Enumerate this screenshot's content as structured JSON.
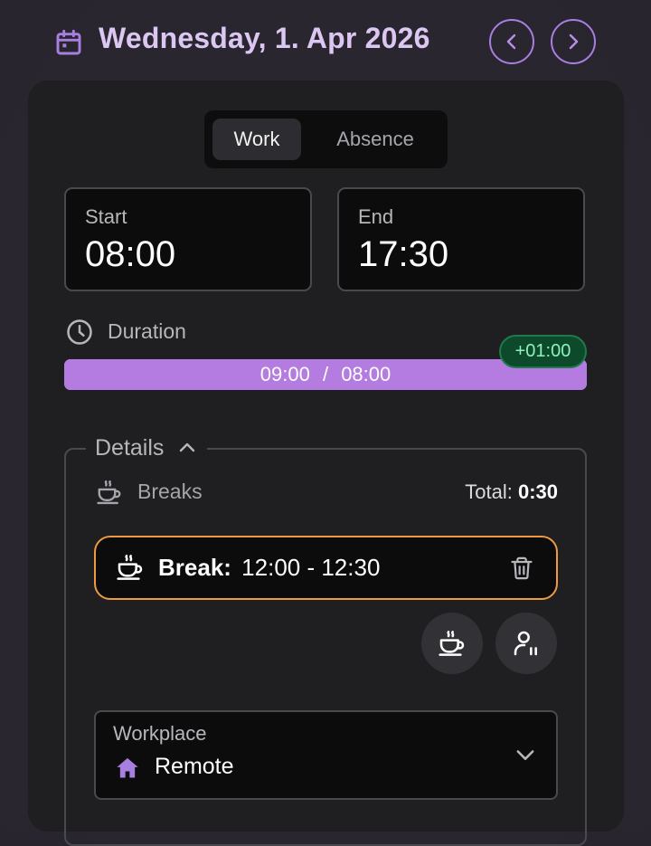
{
  "header": {
    "date_title": "Wednesday, 1. Apr 2026",
    "calendar_icon": "calendar-icon",
    "prev_icon": "chevron-left-icon",
    "next_icon": "chevron-right-icon"
  },
  "mode_toggle": {
    "options": [
      "Work",
      "Absence"
    ],
    "selected": "Work"
  },
  "times": {
    "start_label": "Start",
    "start_value": "08:00",
    "end_label": "End",
    "end_value": "17:30"
  },
  "duration": {
    "label": "Duration",
    "icon": "clock-icon",
    "worked": "09:00",
    "separator": "/",
    "target": "08:00",
    "fill_fraction": 1.0,
    "overtime_badge": "+01:00"
  },
  "details": {
    "label": "Details",
    "expanded_icon": "chevron-up-icon",
    "breaks": {
      "label": "Breaks",
      "icon": "coffee-icon",
      "total_label": "Total:",
      "total_value": "0:30",
      "items": [
        {
          "label": "Break:",
          "range": "12:00 - 12:30"
        }
      ],
      "delete_icon": "trash-icon",
      "add_break_icon": "coffee-icon",
      "person_pause_icon": "person-pause-icon"
    },
    "workplace": {
      "label": "Workplace",
      "value": "Remote",
      "icon": "home-icon",
      "dropdown_icon": "chevron-down-icon"
    }
  },
  "colors": {
    "accent": "#b47be0",
    "title": "#dcc6f2",
    "card_bg": "#1f1e21",
    "break_border": "#ee9a42",
    "overtime_bg": "#0d4a2c",
    "overtime_text": "#8ff0bd"
  }
}
